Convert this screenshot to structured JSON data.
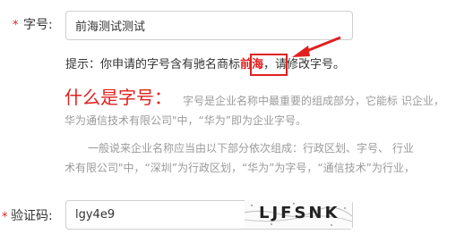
{
  "trade_name": {
    "required_mark": "*",
    "label": "字号:",
    "value": "前海测试测试"
  },
  "hint": {
    "prefix": "提示：你申请的字号含有驰名商标",
    "highlight": "前海",
    "suffix": "，请修改字号。"
  },
  "explain": {
    "title": "什么是字号：",
    "line1": "字号是企业名称中最重要的组成部分，它能标 识企业，",
    "line2": "华为通信技术有限公司\"中，“华为”即为企业字号。",
    "line3": "一般说来企业名称应当由以下部分依次组成：行政区划、字号、 行业",
    "line4": "术有限公司\"中，“深圳”为行政区划，“华为”为字号，“通信技术”为行业，"
  },
  "captcha": {
    "required_mark": "*",
    "label": "验证码:",
    "value": "lgy4e9",
    "image_text": "LJFSNK"
  },
  "colors": {
    "accent_red": "#e02020",
    "muted_text": "#9a9a9a",
    "border": "#cfcfcf"
  }
}
